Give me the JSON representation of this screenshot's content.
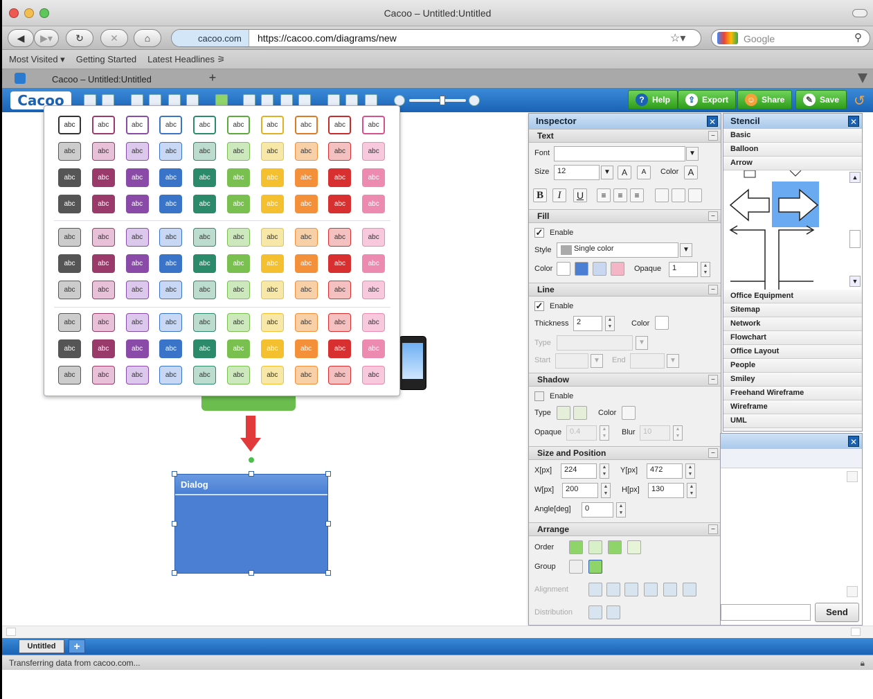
{
  "window": {
    "title": "Cacoo – Untitled:Untitled"
  },
  "nav": {
    "site": "cacoo.com",
    "url": "https://cacoo.com/diagrams/new",
    "search_placeholder": "Google"
  },
  "bookmarks": [
    "Most Visited ▾",
    "Getting Started",
    "Latest Headlines ⚞"
  ],
  "tab": {
    "title": "Cacoo – Untitled:Untitled",
    "new_tab": "+"
  },
  "toolbar": {
    "logo": "Cacoo",
    "help": "Help",
    "export": "Export",
    "share": "Share",
    "save": "Save"
  },
  "palette": {
    "label": "abc"
  },
  "diagram": {
    "dialog_title": "Dialog"
  },
  "inspector": {
    "title": "Inspector",
    "text": {
      "section": "Text",
      "font_label": "Font",
      "font_value": "",
      "size_label": "Size",
      "size_value": "12",
      "color_label": "Color",
      "color_glyph": "A"
    },
    "fill": {
      "section": "Fill",
      "enable": "Enable",
      "style_label": "Style",
      "style_value": "Single color",
      "color_label": "Color",
      "opaque_label": "Opaque",
      "opaque_value": "1"
    },
    "line": {
      "section": "Line",
      "enable": "Enable",
      "thickness_label": "Thickness",
      "thickness_value": "2",
      "color_label": "Color",
      "type_label": "Type",
      "start_label": "Start",
      "end_label": "End"
    },
    "shadow": {
      "section": "Shadow",
      "enable": "Enable",
      "type_label": "Type",
      "color_label": "Color",
      "opaque_label": "Opaque",
      "opaque_value": "0.4",
      "blur_label": "Blur",
      "blur_value": "10"
    },
    "sizepos": {
      "section": "Size and Position",
      "x_label": "X[px]",
      "x_value": "224",
      "y_label": "Y[px]",
      "y_value": "472",
      "w_label": "W[px]",
      "w_value": "200",
      "h_label": "H[px]",
      "h_value": "130",
      "angle_label": "Angle[deg]",
      "angle_value": "0"
    },
    "arrange": {
      "section": "Arrange",
      "order_label": "Order",
      "group_label": "Group",
      "alignment_label": "Alignment",
      "distribution_label": "Distribution"
    }
  },
  "stencil": {
    "title": "Stencil",
    "top_items": [
      "Basic",
      "Balloon",
      "Arrow"
    ],
    "bottom_items": [
      "Office Equipment",
      "Sitemap",
      "Network",
      "Flowchart",
      "Office Layout",
      "People",
      "Smiley",
      "Freehand Wireframe",
      "Wireframe",
      "UML"
    ]
  },
  "chat": {
    "send": "Send"
  },
  "sheet": {
    "tab": "Untitled",
    "add": "+"
  },
  "status": {
    "text": "Transferring data from cacoo.com..."
  },
  "colors": {
    "accent": "#1a62b4",
    "green": "#3fae2a",
    "dialog": "#4a7fd4"
  }
}
